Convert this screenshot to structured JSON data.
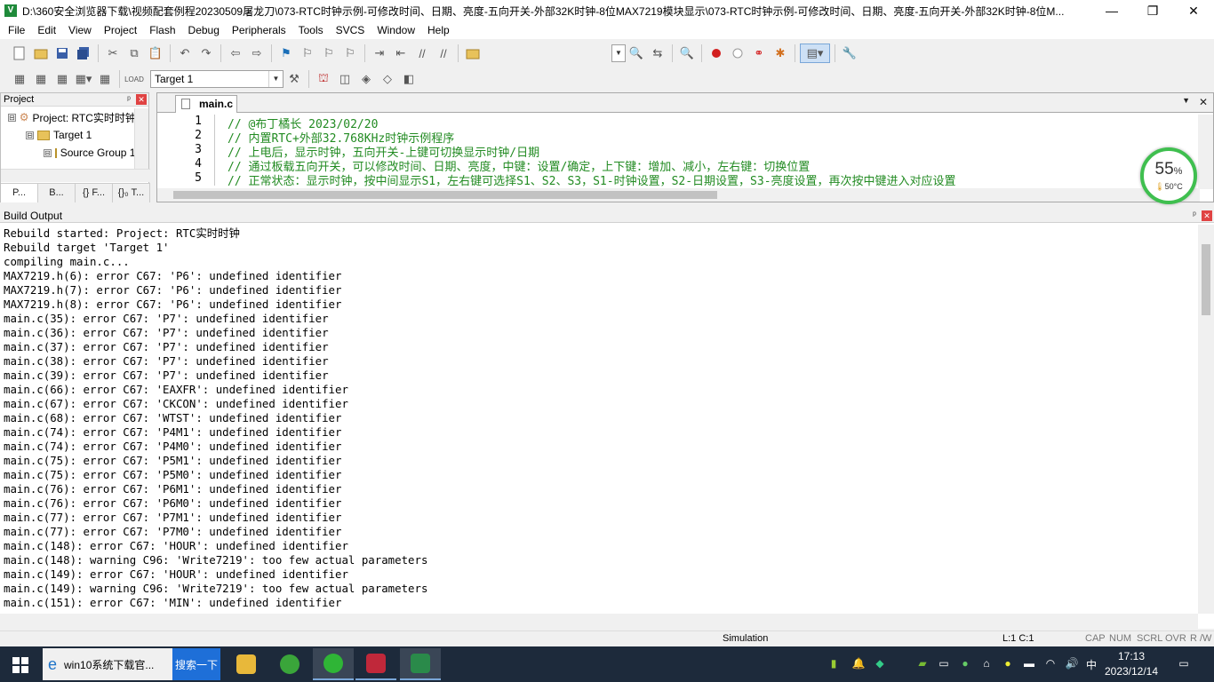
{
  "window": {
    "title": "D:\\360安全浏览器下载\\视频配套例程20230509屠龙刀\\073-RTC时钟示例-可修改时间、日期、亮度-五向开关-外部32K时钟-8位MAX7219模块显示\\073-RTC时钟示例-可修改时间、日期、亮度-五向开关-外部32K时钟-8位M...",
    "minimize": "—",
    "maximize": "❐",
    "close": "✕"
  },
  "menu": [
    "File",
    "Edit",
    "View",
    "Project",
    "Flash",
    "Debug",
    "Peripherals",
    "Tools",
    "SVCS",
    "Window",
    "Help"
  ],
  "toolbar": {
    "target_value": "Target 1",
    "target_arrow": "▼",
    "find_arrow": "▼"
  },
  "project_panel": {
    "title": "Project",
    "pin": "ᵖ",
    "close": "✕",
    "tree": [
      {
        "label": "Project: RTC实时时钟",
        "expander": "⊟"
      },
      {
        "label": "Target 1",
        "expander": "⊟"
      },
      {
        "label": "Source Group 1",
        "expander": "⊟"
      }
    ],
    "tabs": [
      "P...",
      "B...",
      "{} F...",
      "{}₀ T..."
    ]
  },
  "editor": {
    "file_tab": "main.c",
    "tab_dropdown": "▼",
    "tab_close": "✕",
    "lines": [
      {
        "num": "1",
        "text": "//  @布丁橘长 2023/02/20"
      },
      {
        "num": "2",
        "text": "//  内置RTC+外部32.768KHz时钟示例程序"
      },
      {
        "num": "3",
        "text": "//  上电后，显示时钟，五向开关-上键可切换显示时钟/日期"
      },
      {
        "num": "4",
        "text": "//  通过板载五向开关，可以修改时间、日期、亮度，中键：设置/确定，上下键：增加、减小，左右键：切换位置"
      },
      {
        "num": "5",
        "text": "//  正常状态：显示时钟，按中间显示S1，左右键可选择S1、S2、S3，S1-时钟设置，S2-日期设置，S3-亮度设置，再次按中键进入对应设置"
      }
    ]
  },
  "monitor": {
    "percent": "55",
    "percent_sign": "%",
    "temp": "50°C"
  },
  "build_output": {
    "title": "Build Output",
    "lines": [
      "Rebuild started: Project: RTC实时时钟",
      "Rebuild target 'Target 1'",
      "compiling main.c...",
      "MAX7219.h(6): error C67: 'P6': undefined identifier",
      "MAX7219.h(7): error C67: 'P6': undefined identifier",
      "MAX7219.h(8): error C67: 'P6': undefined identifier",
      "main.c(35): error C67: 'P7': undefined identifier",
      "main.c(36): error C67: 'P7': undefined identifier",
      "main.c(37): error C67: 'P7': undefined identifier",
      "main.c(38): error C67: 'P7': undefined identifier",
      "main.c(39): error C67: 'P7': undefined identifier",
      "main.c(66): error C67: 'EAXFR': undefined identifier",
      "main.c(67): error C67: 'CKCON': undefined identifier",
      "main.c(68): error C67: 'WTST': undefined identifier",
      "main.c(74): error C67: 'P4M1': undefined identifier",
      "main.c(74): error C67: 'P4M0': undefined identifier",
      "main.c(75): error C67: 'P5M1': undefined identifier",
      "main.c(75): error C67: 'P5M0': undefined identifier",
      "main.c(76): error C67: 'P6M1': undefined identifier",
      "main.c(76): error C67: 'P6M0': undefined identifier",
      "main.c(77): error C67: 'P7M1': undefined identifier",
      "main.c(77): error C67: 'P7M0': undefined identifier",
      "main.c(148): error C67: 'HOUR': undefined identifier",
      "main.c(148): warning C96: 'Write7219': too few actual parameters",
      "main.c(149): error C67: 'HOUR': undefined identifier",
      "main.c(149): warning C96: 'Write7219': too few actual parameters",
      "main.c(151): error C67: 'MIN': undefined identifier"
    ]
  },
  "status": {
    "mode": "Simulation",
    "position": "L:1 C:1",
    "cap": "CAP",
    "num": "NUM",
    "scrl": "SCRL",
    "ovr": "OVR",
    "rw": "R /W"
  },
  "taskbar": {
    "browser_item": "win10系统下载官...",
    "search_label": "搜索一下",
    "ime": "中",
    "time": "17:13",
    "date": "2023/12/14"
  }
}
